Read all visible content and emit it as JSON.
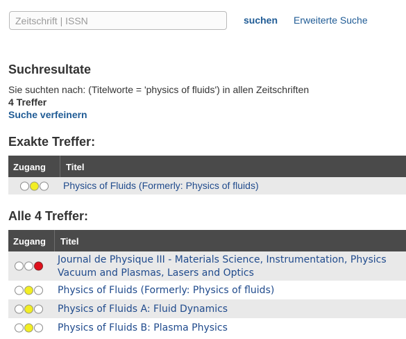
{
  "search": {
    "placeholder": "Zeitschrift | ISSN",
    "button_label": "suchen",
    "advanced_link": "Erweiterte Suche"
  },
  "results": {
    "heading": "Suchresultate",
    "query_text": "Sie suchten nach: (Titelworte = 'physics of fluids') in allen Zeitschriften",
    "hit_count": "4 Treffer",
    "refine_link": "Suche verfeinern"
  },
  "exact": {
    "heading": "Exakte Treffer:",
    "columns": {
      "access": "Zugang",
      "title": "Titel"
    },
    "rows": [
      {
        "lights": [
          "white",
          "yellow",
          "white"
        ],
        "title": "Physics of Fluids (Formerly: Physics of fluids)"
      }
    ]
  },
  "all": {
    "heading": "Alle 4 Treffer:",
    "columns": {
      "access": "Zugang",
      "title": "Titel"
    },
    "rows": [
      {
        "lights": [
          "white",
          "white",
          "red"
        ],
        "title_line1": "Journal de Physique III - Materials Science, Instrumentation, Physics",
        "title_line2": "Vacuum and Plasmas, Lasers and Optics"
      },
      {
        "lights": [
          "white",
          "yellow",
          "white"
        ],
        "title": "Physics of Fluids (Formerly: Physics of fluids)"
      },
      {
        "lights": [
          "white",
          "yellow",
          "white"
        ],
        "title": "Physics of Fluids A: Fluid Dynamics"
      },
      {
        "lights": [
          "white",
          "yellow",
          "white"
        ],
        "title": "Physics of Fluids B: Plasma Physics"
      }
    ]
  },
  "colors": {
    "link": "#1f4a8c",
    "header_bg": "#4a4a4a",
    "light_yellow": "#f2ee24",
    "light_red": "#e0101c"
  }
}
